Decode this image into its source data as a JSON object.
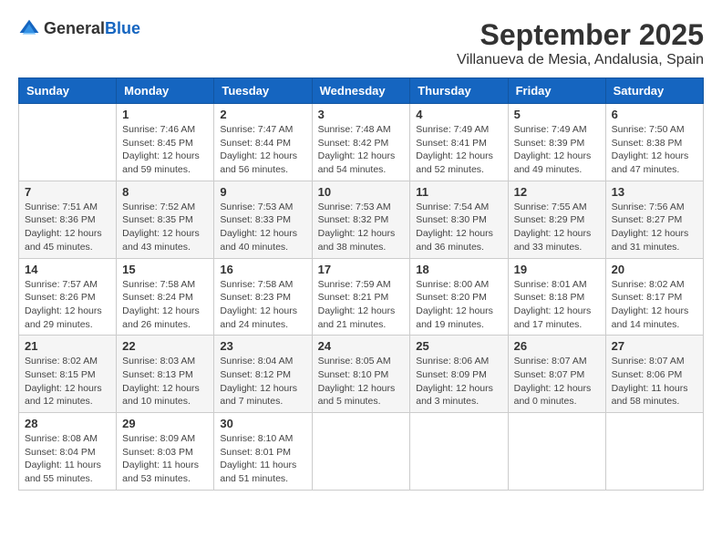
{
  "header": {
    "logo_general": "General",
    "logo_blue": "Blue",
    "month_title": "September 2025",
    "location": "Villanueva de Mesia, Andalusia, Spain"
  },
  "days_of_week": [
    "Sunday",
    "Monday",
    "Tuesday",
    "Wednesday",
    "Thursday",
    "Friday",
    "Saturday"
  ],
  "weeks": [
    [
      {
        "day": "",
        "info": ""
      },
      {
        "day": "1",
        "info": "Sunrise: 7:46 AM\nSunset: 8:45 PM\nDaylight: 12 hours\nand 59 minutes."
      },
      {
        "day": "2",
        "info": "Sunrise: 7:47 AM\nSunset: 8:44 PM\nDaylight: 12 hours\nand 56 minutes."
      },
      {
        "day": "3",
        "info": "Sunrise: 7:48 AM\nSunset: 8:42 PM\nDaylight: 12 hours\nand 54 minutes."
      },
      {
        "day": "4",
        "info": "Sunrise: 7:49 AM\nSunset: 8:41 PM\nDaylight: 12 hours\nand 52 minutes."
      },
      {
        "day": "5",
        "info": "Sunrise: 7:49 AM\nSunset: 8:39 PM\nDaylight: 12 hours\nand 49 minutes."
      },
      {
        "day": "6",
        "info": "Sunrise: 7:50 AM\nSunset: 8:38 PM\nDaylight: 12 hours\nand 47 minutes."
      }
    ],
    [
      {
        "day": "7",
        "info": "Sunrise: 7:51 AM\nSunset: 8:36 PM\nDaylight: 12 hours\nand 45 minutes."
      },
      {
        "day": "8",
        "info": "Sunrise: 7:52 AM\nSunset: 8:35 PM\nDaylight: 12 hours\nand 43 minutes."
      },
      {
        "day": "9",
        "info": "Sunrise: 7:53 AM\nSunset: 8:33 PM\nDaylight: 12 hours\nand 40 minutes."
      },
      {
        "day": "10",
        "info": "Sunrise: 7:53 AM\nSunset: 8:32 PM\nDaylight: 12 hours\nand 38 minutes."
      },
      {
        "day": "11",
        "info": "Sunrise: 7:54 AM\nSunset: 8:30 PM\nDaylight: 12 hours\nand 36 minutes."
      },
      {
        "day": "12",
        "info": "Sunrise: 7:55 AM\nSunset: 8:29 PM\nDaylight: 12 hours\nand 33 minutes."
      },
      {
        "day": "13",
        "info": "Sunrise: 7:56 AM\nSunset: 8:27 PM\nDaylight: 12 hours\nand 31 minutes."
      }
    ],
    [
      {
        "day": "14",
        "info": "Sunrise: 7:57 AM\nSunset: 8:26 PM\nDaylight: 12 hours\nand 29 minutes."
      },
      {
        "day": "15",
        "info": "Sunrise: 7:58 AM\nSunset: 8:24 PM\nDaylight: 12 hours\nand 26 minutes."
      },
      {
        "day": "16",
        "info": "Sunrise: 7:58 AM\nSunset: 8:23 PM\nDaylight: 12 hours\nand 24 minutes."
      },
      {
        "day": "17",
        "info": "Sunrise: 7:59 AM\nSunset: 8:21 PM\nDaylight: 12 hours\nand 21 minutes."
      },
      {
        "day": "18",
        "info": "Sunrise: 8:00 AM\nSunset: 8:20 PM\nDaylight: 12 hours\nand 19 minutes."
      },
      {
        "day": "19",
        "info": "Sunrise: 8:01 AM\nSunset: 8:18 PM\nDaylight: 12 hours\nand 17 minutes."
      },
      {
        "day": "20",
        "info": "Sunrise: 8:02 AM\nSunset: 8:17 PM\nDaylight: 12 hours\nand 14 minutes."
      }
    ],
    [
      {
        "day": "21",
        "info": "Sunrise: 8:02 AM\nSunset: 8:15 PM\nDaylight: 12 hours\nand 12 minutes."
      },
      {
        "day": "22",
        "info": "Sunrise: 8:03 AM\nSunset: 8:13 PM\nDaylight: 12 hours\nand 10 minutes."
      },
      {
        "day": "23",
        "info": "Sunrise: 8:04 AM\nSunset: 8:12 PM\nDaylight: 12 hours\nand 7 minutes."
      },
      {
        "day": "24",
        "info": "Sunrise: 8:05 AM\nSunset: 8:10 PM\nDaylight: 12 hours\nand 5 minutes."
      },
      {
        "day": "25",
        "info": "Sunrise: 8:06 AM\nSunset: 8:09 PM\nDaylight: 12 hours\nand 3 minutes."
      },
      {
        "day": "26",
        "info": "Sunrise: 8:07 AM\nSunset: 8:07 PM\nDaylight: 12 hours\nand 0 minutes."
      },
      {
        "day": "27",
        "info": "Sunrise: 8:07 AM\nSunset: 8:06 PM\nDaylight: 11 hours\nand 58 minutes."
      }
    ],
    [
      {
        "day": "28",
        "info": "Sunrise: 8:08 AM\nSunset: 8:04 PM\nDaylight: 11 hours\nand 55 minutes."
      },
      {
        "day": "29",
        "info": "Sunrise: 8:09 AM\nSunset: 8:03 PM\nDaylight: 11 hours\nand 53 minutes."
      },
      {
        "day": "30",
        "info": "Sunrise: 8:10 AM\nSunset: 8:01 PM\nDaylight: 11 hours\nand 51 minutes."
      },
      {
        "day": "",
        "info": ""
      },
      {
        "day": "",
        "info": ""
      },
      {
        "day": "",
        "info": ""
      },
      {
        "day": "",
        "info": ""
      }
    ]
  ]
}
